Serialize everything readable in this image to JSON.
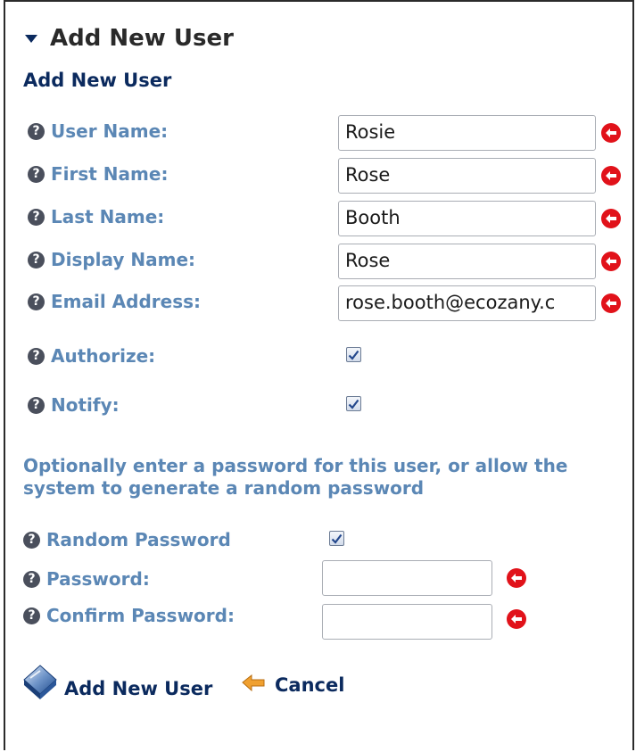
{
  "section": {
    "title": "Add New User"
  },
  "form": {
    "title": "Add New User",
    "help_glyph": "?",
    "fields": [
      {
        "label": "User Name:",
        "value": "Rosie"
      },
      {
        "label": "First Name:",
        "value": "Rose"
      },
      {
        "label": "Last Name:",
        "value": "Booth"
      },
      {
        "label": "Display Name:",
        "value": "Rose"
      },
      {
        "label": "Email Address:",
        "value": "rose.booth@ecozany.c"
      }
    ],
    "checkboxes": [
      {
        "label": "Authorize:",
        "checked": true
      },
      {
        "label": "Notify:",
        "checked": true
      }
    ],
    "password_note": "Optionally enter a password for this user, or allow the system to generate a random password",
    "random_password": {
      "label": "Random Password",
      "checked": true
    },
    "password": {
      "label": "Password:",
      "value": ""
    },
    "confirm_password": {
      "label": "Confirm Password:",
      "value": ""
    }
  },
  "actions": {
    "add_label": "Add New User",
    "cancel_label": "Cancel"
  },
  "colors": {
    "label": "#5b87b5",
    "heading": "#0b2a5e",
    "required": "#e1121a",
    "cancel_arrow": "#f0a030"
  },
  "icons": {
    "help": "help-circle-icon",
    "required": "required-arrow-icon",
    "add": "add-user-diamond-icon",
    "cancel": "back-arrow-icon"
  }
}
